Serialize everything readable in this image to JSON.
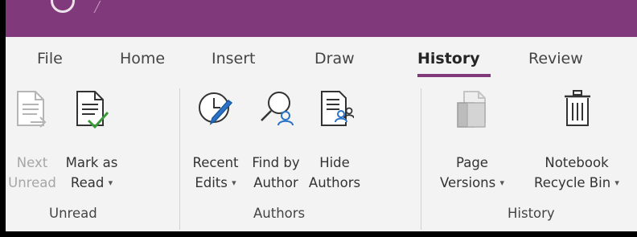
{
  "tabs": [
    {
      "label": "File"
    },
    {
      "label": "Home"
    },
    {
      "label": "Insert"
    },
    {
      "label": "Draw"
    },
    {
      "label": "History"
    },
    {
      "label": "Review"
    }
  ],
  "active_tab": "History",
  "colors": {
    "accent": "#80397b",
    "ribbon_bg": "#f3f3f3",
    "disabled_text": "#a6a6a6",
    "check": "#3a9a3a",
    "blue": "#2b73c7"
  },
  "groups": {
    "unread": {
      "label": "Unread",
      "next_unread": {
        "line1": "Next",
        "line2": "Unread",
        "icon": "next-unread-page-icon",
        "enabled": false
      },
      "mark_as_read": {
        "line1": "Mark as",
        "line2": "Read",
        "dropdown": true,
        "icon": "page-checkmark-icon"
      }
    },
    "authors": {
      "label": "Authors",
      "recent_edits": {
        "line1": "Recent",
        "line2": "Edits",
        "dropdown": true,
        "icon": "clock-pencil-icon"
      },
      "find_by_author": {
        "line1": "Find by",
        "line2": "Author",
        "icon": "magnifier-person-icon"
      },
      "hide_authors": {
        "line1": "Hide",
        "line2": "Authors",
        "icon": "page-person-icon"
      }
    },
    "history": {
      "label": "History",
      "page_versions": {
        "line1": "Page",
        "line2": "Versions",
        "dropdown": true,
        "icon": "page-versions-icon"
      },
      "recycle_bin": {
        "line1": "Notebook",
        "line2": "Recycle Bin",
        "dropdown": true,
        "icon": "trash-can-icon"
      }
    }
  },
  "caret_glyph": "▾"
}
